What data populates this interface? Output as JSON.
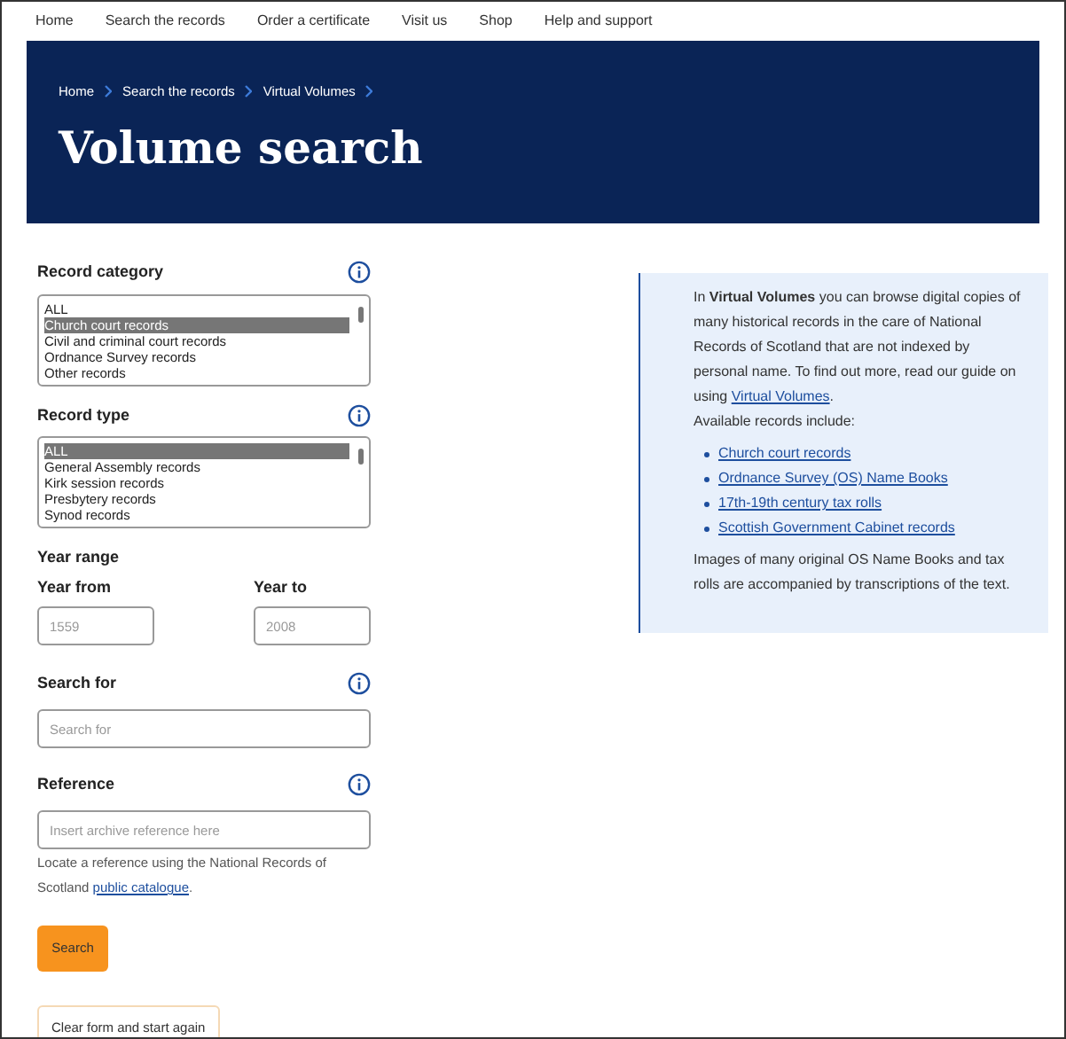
{
  "nav": [
    {
      "label": "Home"
    },
    {
      "label": "Search the records"
    },
    {
      "label": "Order a certificate"
    },
    {
      "label": "Visit us"
    },
    {
      "label": "Shop"
    },
    {
      "label": "Help and support"
    }
  ],
  "breadcrumb": [
    {
      "label": "Home"
    },
    {
      "label": "Search the records"
    },
    {
      "label": "Virtual Volumes"
    }
  ],
  "title": "Volume search",
  "record_category": {
    "label": "Record category",
    "options": [
      {
        "label": "ALL",
        "selected": false
      },
      {
        "label": "Church court records",
        "selected": true
      },
      {
        "label": "Civil and criminal court records",
        "selected": false
      },
      {
        "label": "Ordnance Survey records",
        "selected": false
      },
      {
        "label": "Other records",
        "selected": false
      }
    ]
  },
  "record_type": {
    "label": "Record type",
    "options": [
      {
        "label": "ALL",
        "selected": true
      },
      {
        "label": "General Assembly records",
        "selected": false
      },
      {
        "label": "Kirk session records",
        "selected": false
      },
      {
        "label": "Presbytery records",
        "selected": false
      },
      {
        "label": "Synod records",
        "selected": false
      }
    ]
  },
  "year_range": {
    "label": "Year range",
    "from": {
      "label": "Year from",
      "placeholder": "1559"
    },
    "to": {
      "label": "Year to",
      "placeholder": "2008"
    }
  },
  "search_for": {
    "label": "Search for",
    "placeholder": "Search for"
  },
  "reference": {
    "label": "Reference",
    "placeholder": "Insert archive reference here",
    "hint": "Locate a reference using the National Records of Scotland",
    "hint_link": "public catalogue",
    "hint_after": "."
  },
  "search_button": "Search",
  "clear_button": "Clear form and start again",
  "info": {
    "text": "In **Virtual Volumes** you can browse digital copies of many historical records in the care of National Records of Scotland that are not indexed by personal name. To find out more, read our guide on using",
    "link": "Virtual Volumes",
    "after": ".",
    "list_intro": "Available records include:",
    "links": [
      "Church court records",
      "Ordnance Survey (OS) Name Books",
      "17th-19th century tax rolls",
      "Scottish Government Cabinet records"
    ],
    "footer": "Images of many original OS Name Books and tax rolls are accompanied by transcriptions of the text."
  }
}
